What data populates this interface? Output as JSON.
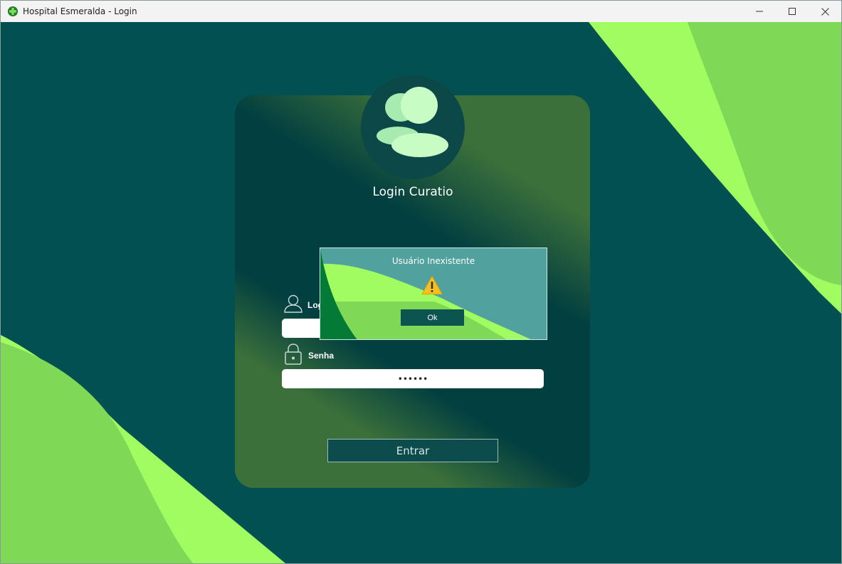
{
  "window": {
    "title": "Hospital Esmeralda - Login",
    "icon": "hospital-cross-icon",
    "controls": [
      "minimize-icon",
      "maximize-icon",
      "close-icon"
    ]
  },
  "login": {
    "title": "Login Curatio",
    "avatar_icon": "users-icon",
    "login_label": "Login",
    "login_icon": "user-icon",
    "login_value": "",
    "password_label": "Senha",
    "password_icon": "lock-icon",
    "password_value": "••••••",
    "submit_label": "Entrar"
  },
  "dialog": {
    "message": "Usuário Inexistente",
    "icon": "warning-icon",
    "ok_label": "Ok"
  },
  "colors": {
    "background": "#025051",
    "card": "#023f40",
    "accent_light": "#a0fc60",
    "accent_mid": "#7fd957",
    "dialog": "#51a19f"
  }
}
